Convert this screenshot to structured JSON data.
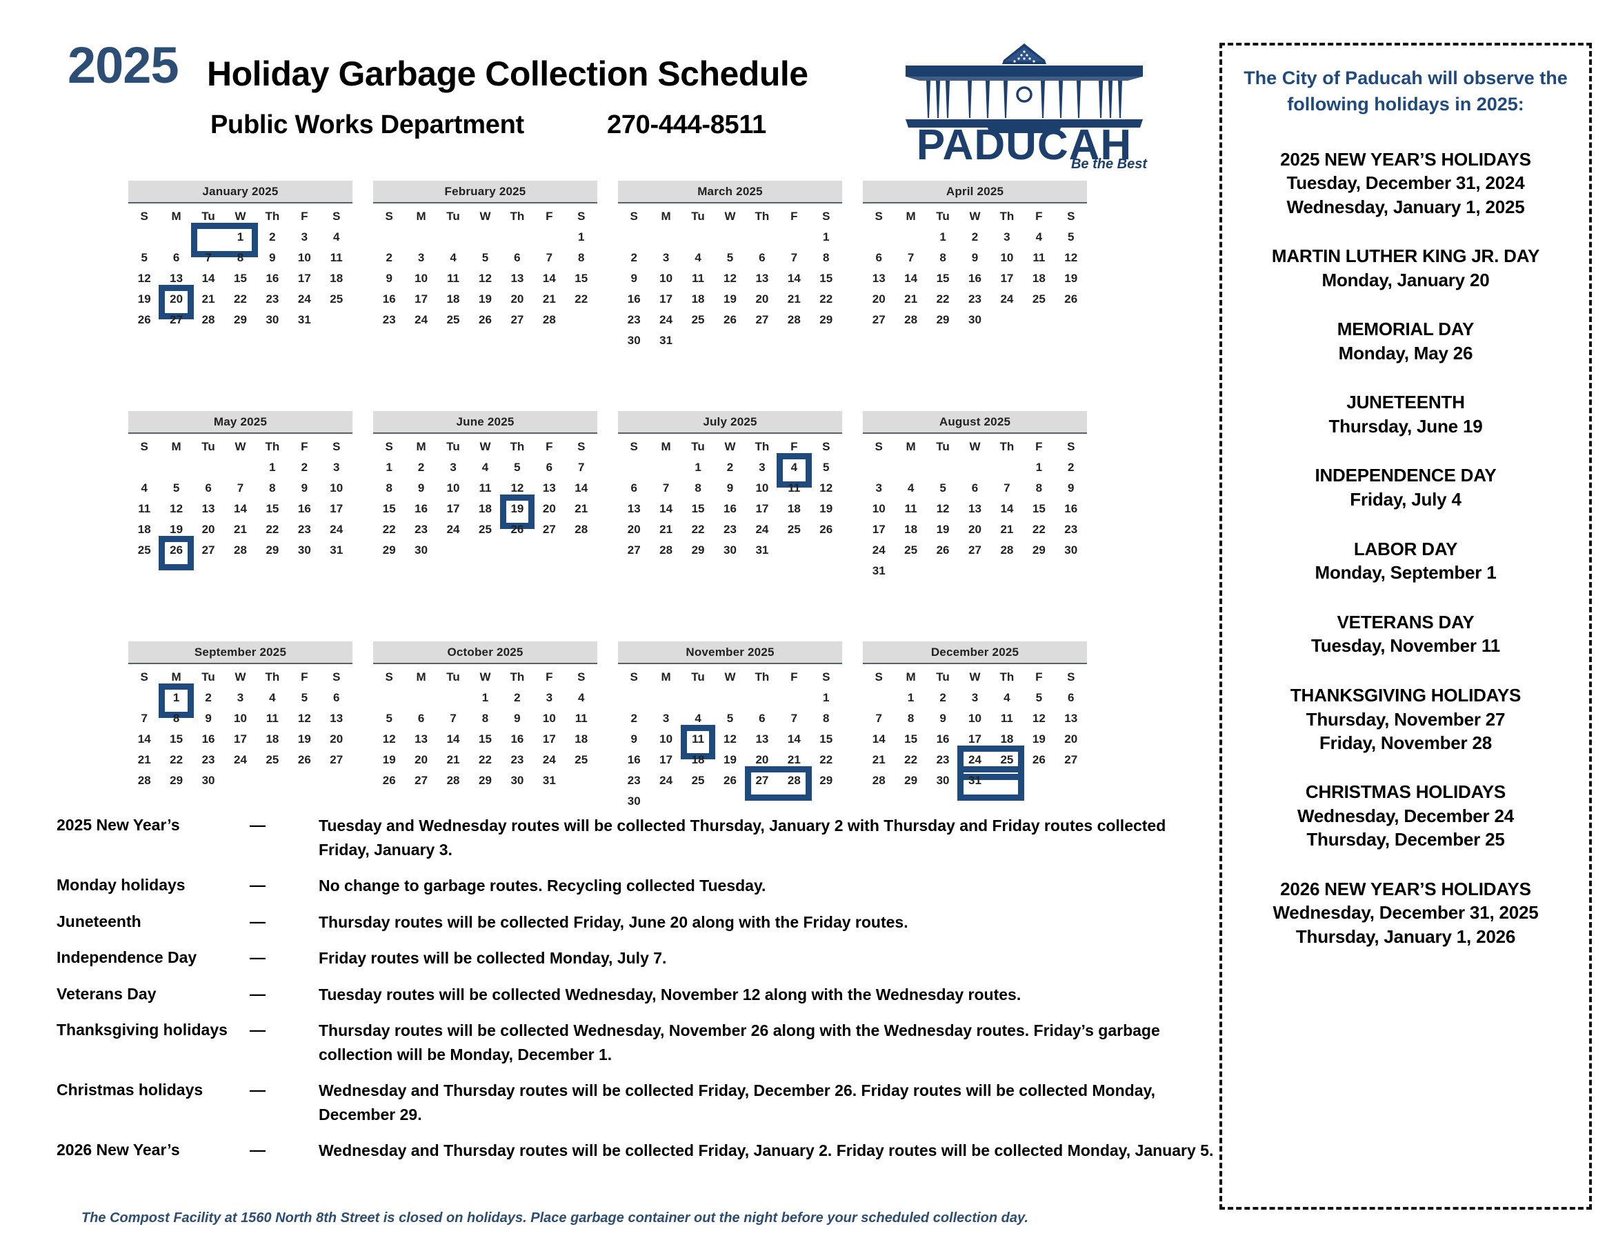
{
  "header": {
    "year": "2025",
    "title": "Holiday Garbage Collection Schedule",
    "department": "Public Works Department",
    "phone": "270-444-8511",
    "logo_name": "PADUCAH",
    "logo_tagline": "Be the Best"
  },
  "calendar": {
    "weekday_headers": [
      "S",
      "M",
      "Tu",
      "W",
      "Th",
      "F",
      "S"
    ],
    "months": [
      {
        "name": "January 2025",
        "weeks": [
          [
            "",
            "",
            "",
            "1",
            "2",
            "3",
            "4"
          ],
          [
            "5",
            "6",
            "7",
            "8",
            "9",
            "10",
            "11"
          ],
          [
            "12",
            "13",
            "14",
            "15",
            "16",
            "17",
            "18"
          ],
          [
            "19",
            "20",
            "21",
            "22",
            "23",
            "24",
            "25"
          ],
          [
            "26",
            "27",
            "28",
            "29",
            "30",
            "31",
            ""
          ],
          [
            "",
            "",
            "",
            "",
            "",
            "",
            ""
          ]
        ],
        "highlights": [
          {
            "row": 0,
            "col": 2,
            "span": 2
          },
          {
            "row": 3,
            "col": 1,
            "span": 1
          }
        ]
      },
      {
        "name": "February 2025",
        "weeks": [
          [
            "",
            "",
            "",
            "",
            "",
            "",
            "1"
          ],
          [
            "2",
            "3",
            "4",
            "5",
            "6",
            "7",
            "8"
          ],
          [
            "9",
            "10",
            "11",
            "12",
            "13",
            "14",
            "15"
          ],
          [
            "16",
            "17",
            "18",
            "19",
            "20",
            "21",
            "22"
          ],
          [
            "23",
            "24",
            "25",
            "26",
            "27",
            "28",
            ""
          ],
          [
            "",
            "",
            "",
            "",
            "",
            "",
            ""
          ]
        ],
        "highlights": []
      },
      {
        "name": "March 2025",
        "weeks": [
          [
            "",
            "",
            "",
            "",
            "",
            "",
            "1"
          ],
          [
            "2",
            "3",
            "4",
            "5",
            "6",
            "7",
            "8"
          ],
          [
            "9",
            "10",
            "11",
            "12",
            "13",
            "14",
            "15"
          ],
          [
            "16",
            "17",
            "18",
            "19",
            "20",
            "21",
            "22"
          ],
          [
            "23",
            "24",
            "25",
            "26",
            "27",
            "28",
            "29"
          ],
          [
            "30",
            "31",
            "",
            "",
            "",
            "",
            ""
          ]
        ],
        "highlights": []
      },
      {
        "name": "April 2025",
        "weeks": [
          [
            "",
            "",
            "1",
            "2",
            "3",
            "4",
            "5"
          ],
          [
            "6",
            "7",
            "8",
            "9",
            "10",
            "11",
            "12"
          ],
          [
            "13",
            "14",
            "15",
            "16",
            "17",
            "18",
            "19"
          ],
          [
            "20",
            "21",
            "22",
            "23",
            "24",
            "25",
            "26"
          ],
          [
            "27",
            "28",
            "29",
            "30",
            "",
            "",
            ""
          ],
          [
            "",
            "",
            "",
            "",
            "",
            "",
            ""
          ]
        ],
        "highlights": []
      },
      {
        "name": "May 2025",
        "weeks": [
          [
            "",
            "",
            "",
            "",
            "1",
            "2",
            "3"
          ],
          [
            "4",
            "5",
            "6",
            "7",
            "8",
            "9",
            "10"
          ],
          [
            "11",
            "12",
            "13",
            "14",
            "15",
            "16",
            "17"
          ],
          [
            "18",
            "19",
            "20",
            "21",
            "22",
            "23",
            "24"
          ],
          [
            "25",
            "26",
            "27",
            "28",
            "29",
            "30",
            "31"
          ],
          [
            "",
            "",
            "",
            "",
            "",
            "",
            ""
          ]
        ],
        "highlights": [
          {
            "row": 4,
            "col": 1,
            "span": 1
          }
        ]
      },
      {
        "name": "June 2025",
        "weeks": [
          [
            "1",
            "2",
            "3",
            "4",
            "5",
            "6",
            "7"
          ],
          [
            "8",
            "9",
            "10",
            "11",
            "12",
            "13",
            "14"
          ],
          [
            "15",
            "16",
            "17",
            "18",
            "19",
            "20",
            "21"
          ],
          [
            "22",
            "23",
            "24",
            "25",
            "26",
            "27",
            "28"
          ],
          [
            "29",
            "30",
            "",
            "",
            "",
            "",
            ""
          ],
          [
            "",
            "",
            "",
            "",
            "",
            "",
            ""
          ]
        ],
        "highlights": [
          {
            "row": 2,
            "col": 4,
            "span": 1
          }
        ]
      },
      {
        "name": "July 2025",
        "weeks": [
          [
            "",
            "",
            "1",
            "2",
            "3",
            "4",
            "5"
          ],
          [
            "6",
            "7",
            "8",
            "9",
            "10",
            "11",
            "12"
          ],
          [
            "13",
            "14",
            "15",
            "16",
            "17",
            "18",
            "19"
          ],
          [
            "20",
            "21",
            "22",
            "23",
            "24",
            "25",
            "26"
          ],
          [
            "27",
            "28",
            "29",
            "30",
            "31",
            "",
            ""
          ],
          [
            "",
            "",
            "",
            "",
            "",
            "",
            ""
          ]
        ],
        "highlights": [
          {
            "row": 0,
            "col": 5,
            "span": 1
          }
        ]
      },
      {
        "name": "August 2025",
        "weeks": [
          [
            "",
            "",
            "",
            "",
            "",
            "1",
            "2"
          ],
          [
            "3",
            "4",
            "5",
            "6",
            "7",
            "8",
            "9"
          ],
          [
            "10",
            "11",
            "12",
            "13",
            "14",
            "15",
            "16"
          ],
          [
            "17",
            "18",
            "19",
            "20",
            "21",
            "22",
            "23"
          ],
          [
            "24",
            "25",
            "26",
            "27",
            "28",
            "29",
            "30"
          ],
          [
            "31",
            "",
            "",
            "",
            "",
            "",
            ""
          ]
        ],
        "highlights": []
      },
      {
        "name": "September 2025",
        "weeks": [
          [
            "",
            "1",
            "2",
            "3",
            "4",
            "5",
            "6"
          ],
          [
            "7",
            "8",
            "9",
            "10",
            "11",
            "12",
            "13"
          ],
          [
            "14",
            "15",
            "16",
            "17",
            "18",
            "19",
            "20"
          ],
          [
            "21",
            "22",
            "23",
            "24",
            "25",
            "26",
            "27"
          ],
          [
            "28",
            "29",
            "30",
            "",
            "",
            "",
            ""
          ],
          [
            "",
            "",
            "",
            "",
            "",
            "",
            ""
          ]
        ],
        "highlights": [
          {
            "row": 0,
            "col": 1,
            "span": 1
          }
        ]
      },
      {
        "name": "October 2025",
        "weeks": [
          [
            "",
            "",
            "",
            "1",
            "2",
            "3",
            "4"
          ],
          [
            "5",
            "6",
            "7",
            "8",
            "9",
            "10",
            "11"
          ],
          [
            "12",
            "13",
            "14",
            "15",
            "16",
            "17",
            "18"
          ],
          [
            "19",
            "20",
            "21",
            "22",
            "23",
            "24",
            "25"
          ],
          [
            "26",
            "27",
            "28",
            "29",
            "30",
            "31",
            ""
          ],
          [
            "",
            "",
            "",
            "",
            "",
            "",
            ""
          ]
        ],
        "highlights": []
      },
      {
        "name": "November 2025",
        "weeks": [
          [
            "",
            "",
            "",
            "",
            "",
            "",
            "1"
          ],
          [
            "2",
            "3",
            "4",
            "5",
            "6",
            "7",
            "8"
          ],
          [
            "9",
            "10",
            "11",
            "12",
            "13",
            "14",
            "15"
          ],
          [
            "16",
            "17",
            "18",
            "19",
            "20",
            "21",
            "22"
          ],
          [
            "23",
            "24",
            "25",
            "26",
            "27",
            "28",
            "29"
          ],
          [
            "30",
            "",
            "",
            "",
            "",
            "",
            ""
          ]
        ],
        "highlights": [
          {
            "row": 2,
            "col": 2,
            "span": 1
          },
          {
            "row": 4,
            "col": 4,
            "span": 2
          }
        ]
      },
      {
        "name": "December 2025",
        "weeks": [
          [
            "",
            "1",
            "2",
            "3",
            "4",
            "5",
            "6"
          ],
          [
            "7",
            "8",
            "9",
            "10",
            "11",
            "12",
            "13"
          ],
          [
            "14",
            "15",
            "16",
            "17",
            "18",
            "19",
            "20"
          ],
          [
            "21",
            "22",
            "23",
            "24",
            "25",
            "26",
            "27"
          ],
          [
            "28",
            "29",
            "30",
            "31",
            "",
            "",
            ""
          ],
          [
            "",
            "",
            "",
            "",
            "",
            "",
            ""
          ]
        ],
        "highlights": [
          {
            "row": 3,
            "col": 3,
            "span": 2
          },
          {
            "row": 4,
            "col": 3,
            "span": 2
          }
        ]
      }
    ]
  },
  "notes": [
    {
      "label": "2025 New Year’s",
      "dash": "—",
      "text": "Tuesday and Wednesday routes will be collected Thursday, January 2 with Thursday and Friday routes collected Friday, January 3."
    },
    {
      "label": "Monday holidays",
      "dash": "—",
      "text": "No change to garbage routes. Recycling collected Tuesday."
    },
    {
      "label": "Juneteenth",
      "dash": "—",
      "text": "Thursday routes will be collected Friday, June 20 along with the Friday routes."
    },
    {
      "label": "Independence Day",
      "dash": "—",
      "text": "Friday routes will be collected Monday, July 7."
    },
    {
      "label": "Veterans Day",
      "dash": "—",
      "text": "Tuesday routes will be collected Wednesday, November 12 along with the Wednesday routes."
    },
    {
      "label": "Thanksgiving holidays",
      "dash": "—",
      "text": "Thursday routes will be collected Wednesday, November 26 along with the Wednesday routes. Friday’s garbage collection will be Monday, December 1."
    },
    {
      "label": "Christmas holidays",
      "dash": "—",
      "text": "Wednesday and Thursday routes will be collected Friday, December 26. Friday routes will be collected Monday, December 29."
    },
    {
      "label": "2026 New Year’s",
      "dash": "—",
      "text": "Wednesday and Thursday routes will be collected Friday, January 2. Friday routes will be collected Monday, January 5."
    }
  ],
  "footnote": "The Compost Facility at 1560 North 8th Street is closed on holidays.   Place garbage container out the night before your scheduled collection day.",
  "sidebar": {
    "intro": "The City of Paducah will observe the following holidays in 2025:",
    "items": [
      {
        "name": "2025 NEW YEAR’S HOLIDAYS",
        "dates": [
          "Tuesday, December 31, 2024",
          "Wednesday, January 1, 2025"
        ]
      },
      {
        "name": "MARTIN LUTHER KING JR. DAY",
        "dates": [
          "Monday, January 20"
        ]
      },
      {
        "name": "MEMORIAL DAY",
        "dates": [
          "Monday, May 26"
        ]
      },
      {
        "name": "JUNETEENTH",
        "dates": [
          "Thursday, June 19"
        ]
      },
      {
        "name": "INDEPENDENCE DAY",
        "dates": [
          "Friday, July 4"
        ]
      },
      {
        "name": "LABOR DAY",
        "dates": [
          "Monday, September 1"
        ]
      },
      {
        "name": "VETERANS DAY",
        "dates": [
          "Tuesday, November 11"
        ]
      },
      {
        "name": "THANKSGIVING  HOLIDAYS",
        "dates": [
          "Thursday, November 27",
          "Friday, November 28"
        ]
      },
      {
        "name": "CHRISTMAS HOLIDAYS",
        "dates": [
          "Wednesday, December 24",
          "Thursday, December 25"
        ]
      },
      {
        "name": "2026 NEW YEAR’S HOLIDAYS",
        "dates": [
          "Wednesday, December 31, 2025",
          "Thursday, January 1, 2026"
        ]
      }
    ]
  },
  "colors": {
    "brand_blue": "#1f4a7d",
    "logo_blue": "#2c4e74",
    "month_header_bg": "#dcdcdc"
  }
}
